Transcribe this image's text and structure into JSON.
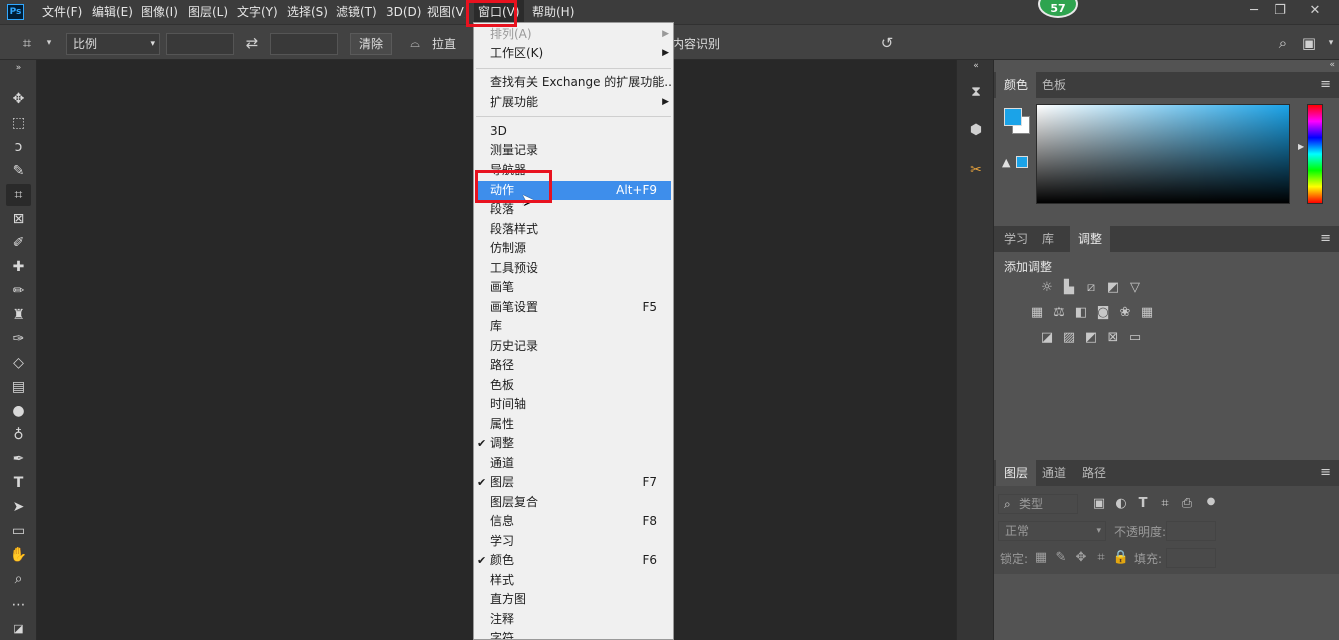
{
  "app": {
    "logo": "Ps"
  },
  "menubar": {
    "items": [
      "文件(F)",
      "编辑(E)",
      "图像(I)",
      "图层(L)",
      "文字(Y)",
      "选择(S)",
      "滤镜(T)",
      "3D(D)",
      "视图(V)",
      "窗口(V)",
      "帮助(H)"
    ],
    "badge": "57"
  },
  "options": {
    "ratio_select": "比例",
    "clear_button": "清除",
    "straighten_label": "拉直",
    "content_aware_label": "内容识别"
  },
  "dropdown": {
    "items": [
      {
        "label": "排列(A)",
        "shortcut": "",
        "check": false,
        "submenu": true,
        "disabled": true
      },
      {
        "label": "工作区(K)",
        "shortcut": "",
        "check": false,
        "submenu": true,
        "disabled": false
      },
      {
        "label": "查找有关 Exchange 的扩展功能...",
        "shortcut": "",
        "check": false,
        "submenu": false,
        "disabled": false
      },
      {
        "label": "扩展功能",
        "shortcut": "",
        "check": false,
        "submenu": true,
        "disabled": false
      },
      {
        "label": "3D",
        "shortcut": "",
        "check": false,
        "submenu": false,
        "disabled": false
      },
      {
        "label": "测量记录",
        "shortcut": "",
        "check": false,
        "submenu": false,
        "disabled": false
      },
      {
        "label": "导航器",
        "shortcut": "",
        "check": false,
        "submenu": false,
        "disabled": false
      },
      {
        "label": "动作",
        "shortcut": "Alt+F9",
        "check": false,
        "submenu": false,
        "disabled": false,
        "highlighted": true
      },
      {
        "label": "段落",
        "shortcut": "",
        "check": false,
        "submenu": false,
        "disabled": false
      },
      {
        "label": "段落样式",
        "shortcut": "",
        "check": false,
        "submenu": false,
        "disabled": false
      },
      {
        "label": "仿制源",
        "shortcut": "",
        "check": false,
        "submenu": false,
        "disabled": false
      },
      {
        "label": "工具预设",
        "shortcut": "",
        "check": false,
        "submenu": false,
        "disabled": false
      },
      {
        "label": "画笔",
        "shortcut": "",
        "check": false,
        "submenu": false,
        "disabled": false
      },
      {
        "label": "画笔设置",
        "shortcut": "F5",
        "check": false,
        "submenu": false,
        "disabled": false
      },
      {
        "label": "库",
        "shortcut": "",
        "check": false,
        "submenu": false,
        "disabled": false
      },
      {
        "label": "历史记录",
        "shortcut": "",
        "check": false,
        "submenu": false,
        "disabled": false
      },
      {
        "label": "路径",
        "shortcut": "",
        "check": false,
        "submenu": false,
        "disabled": false
      },
      {
        "label": "色板",
        "shortcut": "",
        "check": false,
        "submenu": false,
        "disabled": false
      },
      {
        "label": "时间轴",
        "shortcut": "",
        "check": false,
        "submenu": false,
        "disabled": false
      },
      {
        "label": "属性",
        "shortcut": "",
        "check": false,
        "submenu": false,
        "disabled": false
      },
      {
        "label": "调整",
        "shortcut": "",
        "check": true,
        "submenu": false,
        "disabled": false
      },
      {
        "label": "通道",
        "shortcut": "",
        "check": false,
        "submenu": false,
        "disabled": false
      },
      {
        "label": "图层",
        "shortcut": "F7",
        "check": true,
        "submenu": false,
        "disabled": false
      },
      {
        "label": "图层复合",
        "shortcut": "",
        "check": false,
        "submenu": false,
        "disabled": false
      },
      {
        "label": "信息",
        "shortcut": "F8",
        "check": false,
        "submenu": false,
        "disabled": false
      },
      {
        "label": "学习",
        "shortcut": "",
        "check": false,
        "submenu": false,
        "disabled": false
      },
      {
        "label": "颜色",
        "shortcut": "F6",
        "check": true,
        "submenu": false,
        "disabled": false
      },
      {
        "label": "样式",
        "shortcut": "",
        "check": false,
        "submenu": false,
        "disabled": false
      },
      {
        "label": "直方图",
        "shortcut": "",
        "check": false,
        "submenu": false,
        "disabled": false
      },
      {
        "label": "注释",
        "shortcut": "",
        "check": false,
        "submenu": false,
        "disabled": false
      },
      {
        "label": "字符",
        "shortcut": "",
        "check": false,
        "submenu": false,
        "disabled": false
      }
    ]
  },
  "color_panel": {
    "tabs": [
      "颜色",
      "色板"
    ],
    "foreground": "#1ba3e8",
    "background": "#ffffff"
  },
  "adjust_panel": {
    "tabs": [
      "学习",
      "库",
      "调整"
    ],
    "title": "添加调整"
  },
  "layers_panel": {
    "tabs": [
      "图层",
      "通道",
      "路径"
    ],
    "filter_placeholder": "类型",
    "blend_mode": "正常",
    "opacity_label": "不透明度:",
    "lock_label": "锁定:",
    "fill_label": "填充:"
  },
  "colors": {
    "accent": "#3e8eeb",
    "annotation": "#e8121f"
  }
}
